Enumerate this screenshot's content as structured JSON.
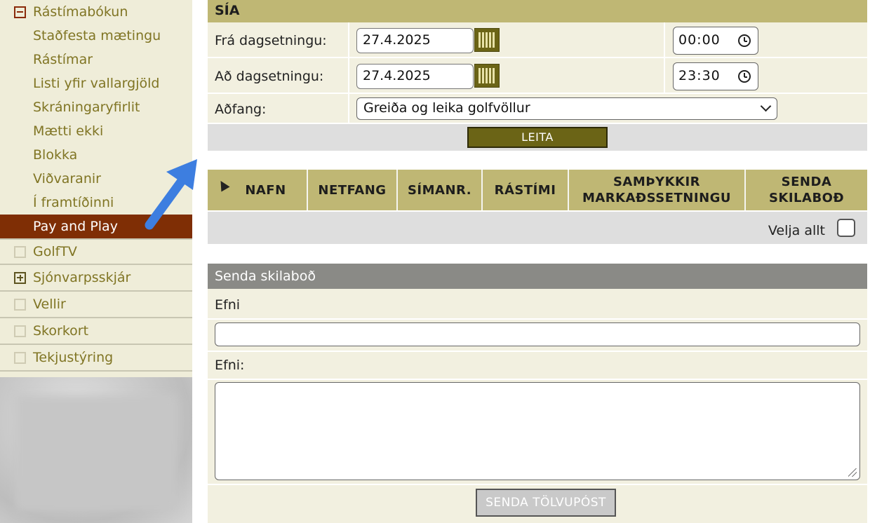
{
  "sidebar": {
    "top_label": "Rástímabókun",
    "sub_items": [
      {
        "label": "Staðfesta mætingu"
      },
      {
        "label": "Rástímar"
      },
      {
        "label": "Listi yfir vallargjöld"
      },
      {
        "label": "Skráningaryfirlit"
      },
      {
        "label": "Mætti ekki"
      },
      {
        "label": "Blokka"
      },
      {
        "label": "Viðvaranir"
      },
      {
        "label": "Í framtíðinni"
      },
      {
        "label": "Pay and Play"
      }
    ],
    "active_item": "Pay and Play",
    "categories": [
      {
        "label": "GolfTV",
        "icon": "empty-square-icon"
      },
      {
        "label": "Sjónvarpsskjár",
        "icon": "plus-square-icon"
      },
      {
        "label": "Vellir",
        "icon": "empty-square-icon"
      },
      {
        "label": "Skorkort",
        "icon": "empty-square-icon"
      },
      {
        "label": "Tekjustýring",
        "icon": "empty-square-icon"
      }
    ]
  },
  "filter": {
    "title": "SÍA",
    "from_label": "Frá dagsetningu:",
    "from_date": "27.4.2025",
    "from_time": "00:00",
    "to_label": "Að dagsetningu:",
    "to_date": "27.4.2025",
    "to_time": "23:30",
    "resource_label": "Aðfang:",
    "resource_value": "Greiða og leika golfvöllur",
    "search_button": "LEITA"
  },
  "results": {
    "columns": [
      "NAFN",
      "NETFANG",
      "SÍMANR.",
      "RÁSTÍMI",
      "SAMÞYKKIR MARKAÐSSETNINGU",
      "SENDA SKILABOÐ"
    ],
    "select_all_label": "Velja allt"
  },
  "message": {
    "title": "Senda skilaboð",
    "subject_label": "Efni",
    "body_label": "Efni:",
    "send_button": "SENDA TÖLVUPÓST"
  },
  "colors": {
    "header_olive": "#bfb774",
    "active_bg": "#7f2e05",
    "button_olive": "#6b6416",
    "sidebar_text": "#807524",
    "arrow_blue": "#3d7ee0"
  }
}
